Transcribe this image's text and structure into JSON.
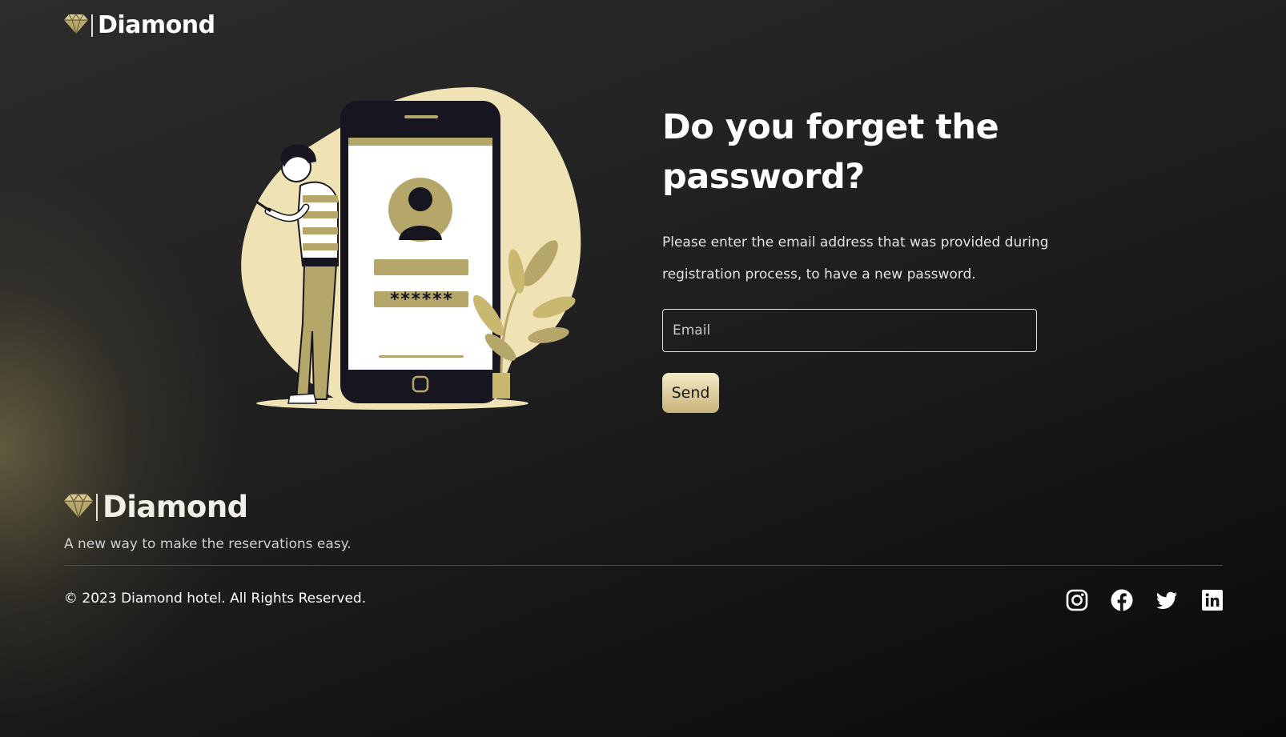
{
  "header": {
    "brand_name": "Diamond"
  },
  "main": {
    "heading": "Do you forget the password?",
    "description": "Please enter the email address that was provided during registration process, to have a new password.",
    "email_placeholder": "Email",
    "send_label": "Send",
    "illustration": {
      "password_mask": "******"
    }
  },
  "footer": {
    "brand_name": "Diamond",
    "tagline": "A new way to make the reservations easy.",
    "copyright": "© 2023 Diamond hotel. All Rights Reserved.",
    "social": [
      "instagram-icon",
      "facebook-icon",
      "twitter-icon",
      "linkedin-icon"
    ]
  },
  "colors": {
    "accent_gold": "#b5a66a",
    "accent_light": "#efe3b5",
    "background": "#1c1c1c"
  }
}
